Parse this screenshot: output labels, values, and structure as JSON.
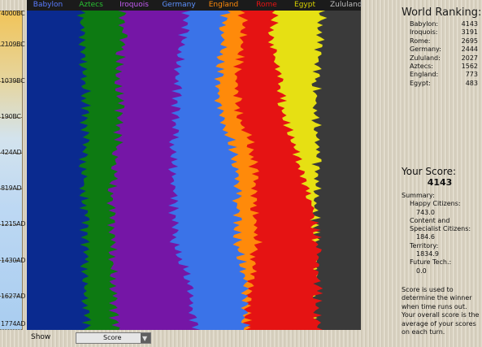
{
  "legend": [
    {
      "name": "Babylon",
      "color": "#0a2a8f"
    },
    {
      "name": "Aztecs",
      "color": "#0d7a12"
    },
    {
      "name": "Iroquois",
      "color": "#7516a6"
    },
    {
      "name": "Germany",
      "color": "#3a73e8"
    },
    {
      "name": "England",
      "color": "#ff8a0a"
    },
    {
      "name": "Rome",
      "color": "#e51313"
    },
    {
      "name": "Egypt",
      "color": "#e6e013"
    },
    {
      "name": "Zululand",
      "color": "#3a3a3a"
    }
  ],
  "timeline": [
    "4000BC",
    "2109BC",
    "1039BC",
    "190BC",
    "424AD",
    "819AD",
    "1215AD",
    "1430AD",
    "1627AD",
    "1774AD"
  ],
  "bottom": {
    "show_label": "Show",
    "select_value": "Score",
    "select_arrow": "▼"
  },
  "panel": {
    "ranking_title": "World Ranking:",
    "ranking": [
      {
        "name": "Babylon:",
        "score": "4143"
      },
      {
        "name": "Iroquois:",
        "score": "3191"
      },
      {
        "name": "Rome:",
        "score": "2695"
      },
      {
        "name": "Germany:",
        "score": "2444"
      },
      {
        "name": "Zululand:",
        "score": "2027"
      },
      {
        "name": "Aztecs:",
        "score": "1562"
      },
      {
        "name": "England:",
        "score": "773"
      },
      {
        "name": "Egypt:",
        "score": "483"
      }
    ],
    "score_title": "Your Score:",
    "score_value": "4143",
    "summary_title": "Summary:",
    "happy_label": "Happy Citizens:",
    "happy_value": "743.0",
    "content_label": "Content and Specialist Citizens:",
    "content_value": "184.6",
    "territory_label": "Territory:",
    "territory_value": "1834.9",
    "future_label": "Future Tech.:",
    "future_value": "0.0",
    "note": "Score is used to determine the winner when time runs out. Your overall score is the average of your scores on each turn."
  }
}
